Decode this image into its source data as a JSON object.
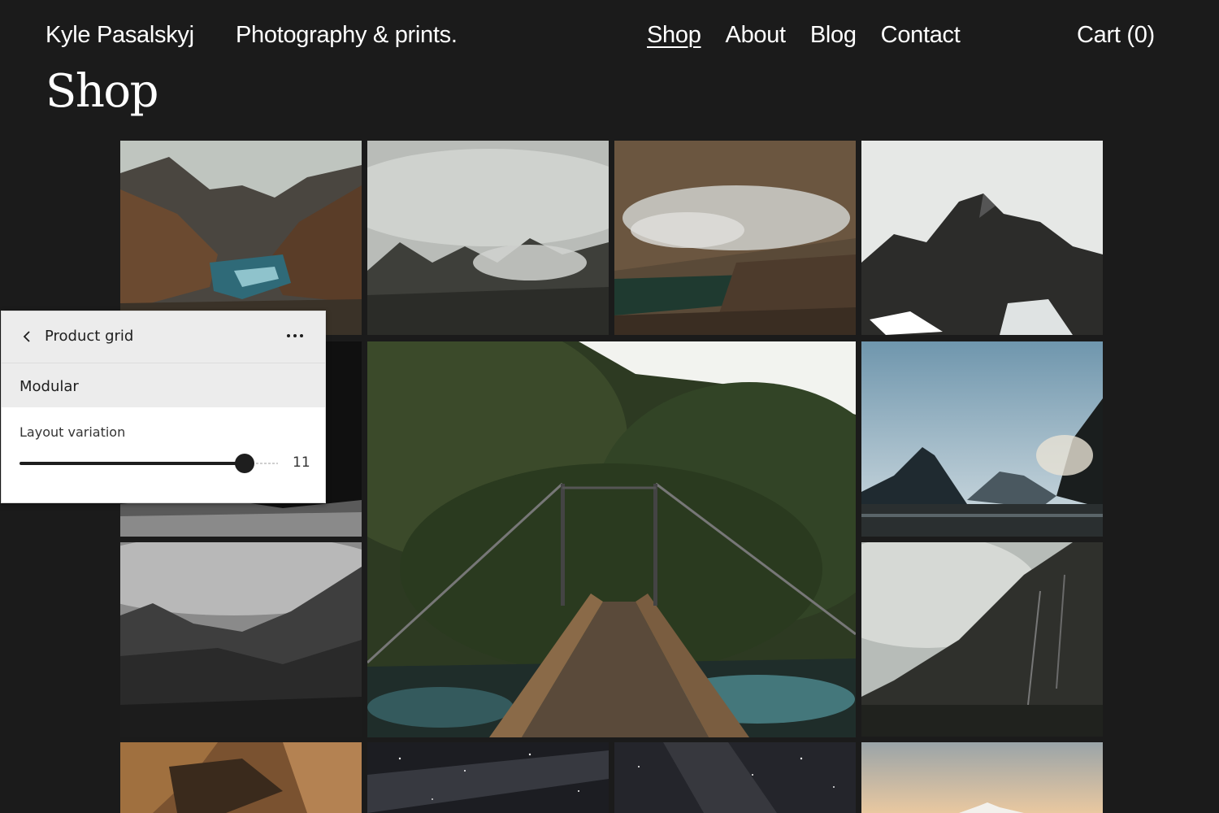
{
  "header": {
    "brand": "Kyle Pasalskyj",
    "tagline": "Photography & prints.",
    "nav": [
      {
        "label": "Shop",
        "active": true
      },
      {
        "label": "About",
        "active": false
      },
      {
        "label": "Blog",
        "active": false
      },
      {
        "label": "Contact",
        "active": false
      }
    ],
    "cart_label": "Cart (0)"
  },
  "page": {
    "title": "Shop"
  },
  "panel": {
    "back_icon": "chevron-left-icon",
    "title": "Product grid",
    "more_icon": "more-horizontal-icon",
    "section": "Modular",
    "control": {
      "label": "Layout variation",
      "value": "11",
      "fill_fraction": 0.87
    }
  },
  "grid": {
    "photos": [
      "mountain-lake-valley",
      "misty-mountain-peaks",
      "clouds-over-alpine-lake",
      "rocky-snow-peak",
      "dark-mountain-slope",
      "forest-suspension-bridge",
      "fjord-peaks-at-dusk",
      "black-and-white-misty-valley",
      "cliff-waterfalls-haze",
      "rocky-gorge",
      "milky-way-night-sky",
      "starry-sky-over-ridge",
      "peak-at-sunset"
    ]
  },
  "colors": {
    "background": "#1b1b1b",
    "text": "#ffffff",
    "panel_header": "#ececec",
    "panel_text": "#1e1e1e"
  }
}
